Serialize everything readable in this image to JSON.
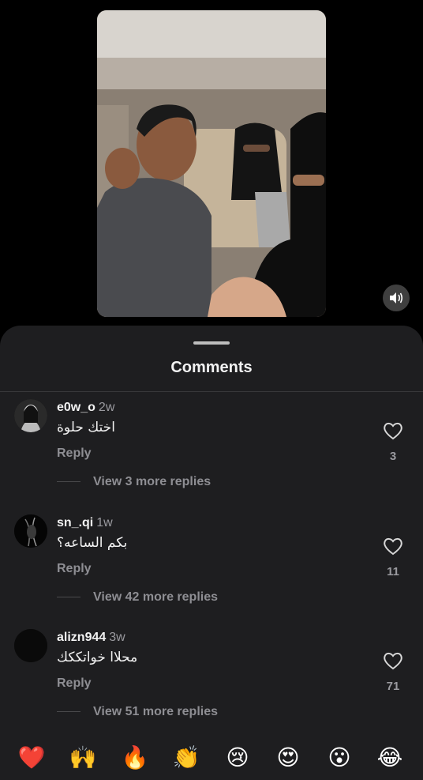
{
  "colors": {
    "background": "#000000",
    "sheet": "#1e1e20",
    "secondary_text": "#8e8e93",
    "primary_text": "#f2f2f2"
  },
  "video": {
    "mute_icon": "speaker-icon"
  },
  "sheet": {
    "title": "Comments"
  },
  "comments": [
    {
      "username": "e0w_o",
      "age": "2w",
      "text": "اختك حلوة",
      "reply_label": "Reply",
      "likes": "3",
      "view_replies": "View 3 more replies"
    },
    {
      "username": "sn_.qi",
      "age": "1w",
      "text": "بكم الساعه؟",
      "reply_label": "Reply",
      "likes": "11",
      "view_replies": "View 42 more replies"
    },
    {
      "username": "alizn944",
      "age": "3w",
      "text": "محلاا خواتككك",
      "reply_label": "Reply",
      "likes": "71",
      "view_replies": "View 51 more replies"
    }
  ],
  "reactions": [
    {
      "name": "red-heart",
      "glyph": "❤️"
    },
    {
      "name": "raising-hands",
      "glyph": "🙌"
    },
    {
      "name": "fire",
      "glyph": "🔥"
    },
    {
      "name": "clapping-hands",
      "glyph": "👏"
    },
    {
      "name": "crying-face",
      "glyph": "😢"
    },
    {
      "name": "heart-eyes",
      "glyph": "😍"
    },
    {
      "name": "surprised-face",
      "glyph": "😮"
    },
    {
      "name": "laughing-face",
      "glyph": "😂"
    }
  ]
}
